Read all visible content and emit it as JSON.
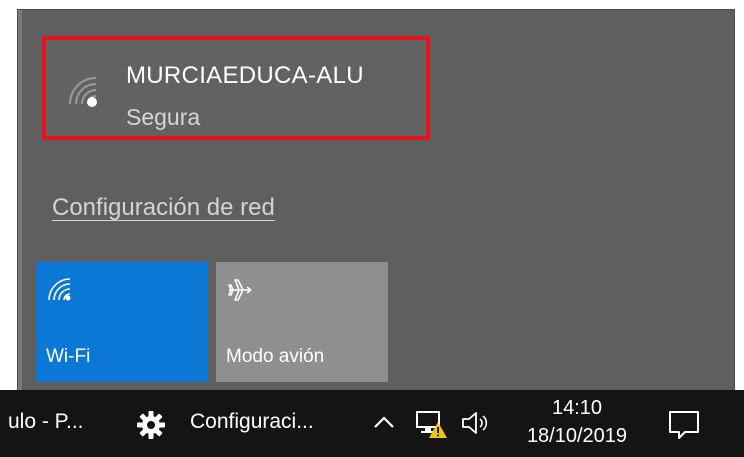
{
  "network_flyout": {
    "network": {
      "name": "MURCIAEDUCA-ALU",
      "status": "Segura"
    },
    "settings_link": "Configuración de red",
    "tiles": [
      {
        "label": "Wi-Fi",
        "icon": "wifi-icon",
        "state": "on",
        "color": "#0a78d4"
      },
      {
        "label": "Modo avión",
        "icon": "airplane-icon",
        "state": "off",
        "color": "#8f8f8f"
      }
    ],
    "highlight_color": "#e8101d"
  },
  "taskbar": {
    "apps": [
      {
        "label": "ulo - P..."
      },
      {
        "label": "Configuraci...",
        "icon": "gear-icon"
      }
    ],
    "tray": {
      "icons": [
        "chevron-up-icon",
        "network-warning-icon",
        "volume-icon"
      ]
    },
    "clock": {
      "time": "14:10",
      "date": "18/10/2019"
    },
    "notification_icon": "action-center-icon"
  }
}
